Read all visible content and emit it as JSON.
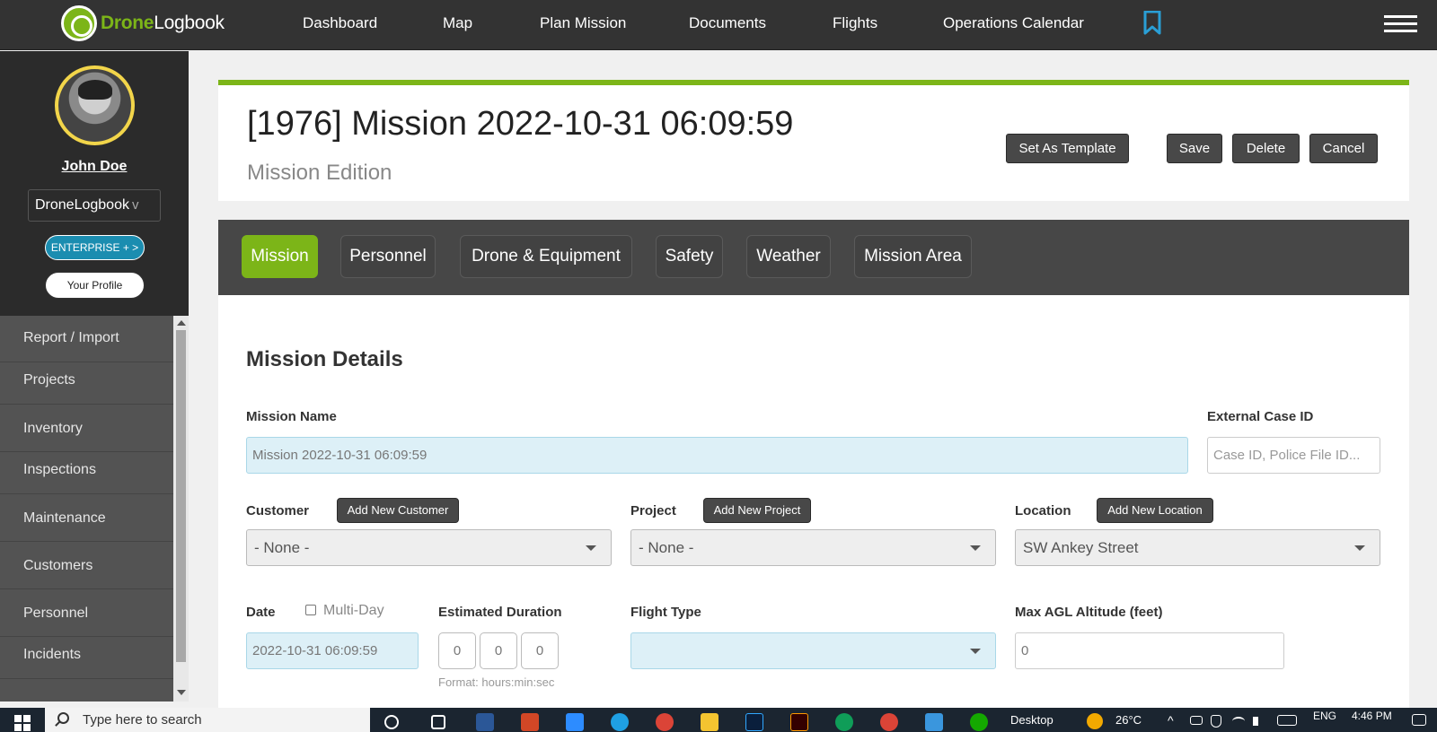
{
  "brand": {
    "part1": "Drone",
    "part2": "Logbook"
  },
  "nav": {
    "links": [
      "Dashboard",
      "Map",
      "Plan Mission",
      "Documents",
      "Flights",
      "Operations Calendar"
    ]
  },
  "user": {
    "name": "John Doe",
    "org": "DroneLogbook",
    "org_chevron": "v",
    "enterprise_label": "ENTERPRISE + >",
    "profile_label": "Your Profile"
  },
  "sidebar": {
    "items": [
      "Report / Import",
      "Projects",
      "Inventory",
      "Inspections",
      "Maintenance",
      "Customers",
      "Personnel",
      "Incidents"
    ]
  },
  "header": {
    "title": "[1976] Mission 2022-10-31 06:09:59",
    "subtitle": "Mission Edition",
    "buttons": {
      "template": "Set As Template",
      "save": "Save",
      "delete": "Delete",
      "cancel": "Cancel"
    }
  },
  "tabs": [
    "Mission",
    "Personnel",
    "Drone & Equipment",
    "Safety",
    "Weather",
    "Mission Area"
  ],
  "active_tab": "Mission",
  "form": {
    "section_title": "Mission Details",
    "mission_name": {
      "label": "Mission Name",
      "value": "Mission 2022-10-31 06:09:59"
    },
    "external_case": {
      "label": "External Case ID",
      "placeholder": "Case ID, Police File ID..."
    },
    "customer": {
      "label": "Customer",
      "button": "Add New Customer",
      "value": "- None -"
    },
    "project": {
      "label": "Project",
      "button": "Add New Project",
      "value": "- None -"
    },
    "location": {
      "label": "Location",
      "button": "Add New Location",
      "value": "SW Ankey Street"
    },
    "date": {
      "label": "Date",
      "multi_day_label": "Multi-Day",
      "multi_day_checked": false,
      "value": "2022-10-31 06:09:59"
    },
    "duration": {
      "label": "Estimated Duration",
      "hours": "0",
      "minutes": "0",
      "seconds": "0",
      "hint": "Format: hours:min:sec"
    },
    "flight_type": {
      "label": "Flight Type",
      "value": ""
    },
    "max_agl": {
      "label": "Max AGL Altitude (feet)",
      "value": "0"
    }
  },
  "taskbar": {
    "search_placeholder": "Type here to search",
    "desktop_label": "Desktop",
    "temperature": "26°C",
    "language": "ENG",
    "time": "4:46 PM"
  },
  "colors": {
    "accent_green": "#7cb518",
    "nav_bg": "#333333",
    "enterprise_blue": "#1b8db0",
    "bookmark_blue": "#2a9fd6"
  }
}
